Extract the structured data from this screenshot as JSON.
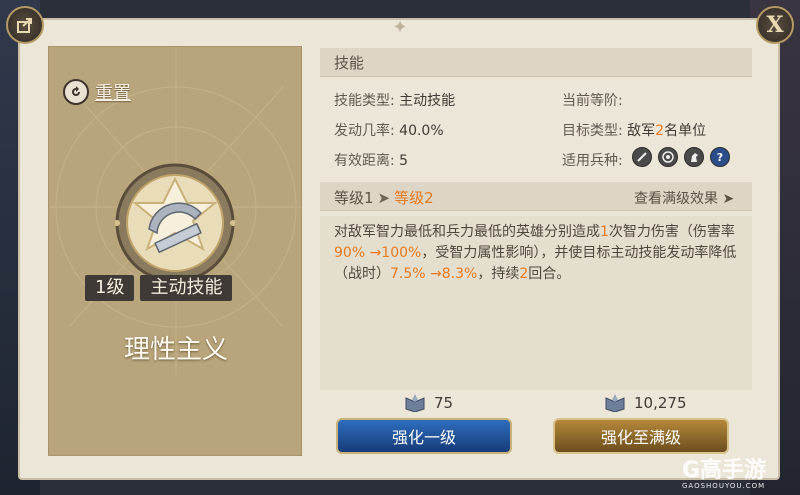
{
  "header": {
    "section_title": "技能"
  },
  "skill_card": {
    "reset_label": "重置",
    "level_badge": "1级",
    "type_badge": "主动技能",
    "name": "理性主义"
  },
  "info": {
    "skill_type_label": "技能类型:",
    "skill_type_value": "主动技能",
    "current_rank_label": "当前等阶:",
    "trigger_rate_label": "发动几率:",
    "trigger_rate_value": "40.0%",
    "target_type_label": "目标类型:",
    "target_type_prefix": "敌军",
    "target_type_count": "2",
    "target_type_suffix": "名单位",
    "range_label": "有效距离:",
    "range_value": "5",
    "troop_label": "适用兵种:",
    "troop_icons": [
      "infantry-icon",
      "archer-icon",
      "cavalry-icon",
      "unknown-icon"
    ],
    "unknown_symbol": "?"
  },
  "levels": {
    "level1": "等级1",
    "level2": "等级2",
    "arrow": "➤",
    "view_full": "查看满级效果 ➤"
  },
  "description": {
    "p1": "对敌军智力最低和兵力最低的英雄分别造成",
    "hit_count": "1",
    "p2": "次智力伤害（伤害率",
    "dmg_range": "90% →100%",
    "p3": "，受智力属性影响），并使目标主动技能发动率降低（战时）",
    "rate_range": "7.5% →8.3%",
    "p4": "，持续",
    "rounds": "2",
    "p5": "回合。"
  },
  "costs": {
    "upgrade_one": "75",
    "upgrade_max": "10,275"
  },
  "buttons": {
    "upgrade_one": "强化一级",
    "upgrade_max": "强化至满级"
  },
  "watermark": {
    "brand": "G高手游",
    "site": "GAOSHOUYOU.COM"
  },
  "colors": {
    "highlight": "#e67a1e",
    "blue_button": "#2e6ebf",
    "gold_button": "#b5893a"
  }
}
